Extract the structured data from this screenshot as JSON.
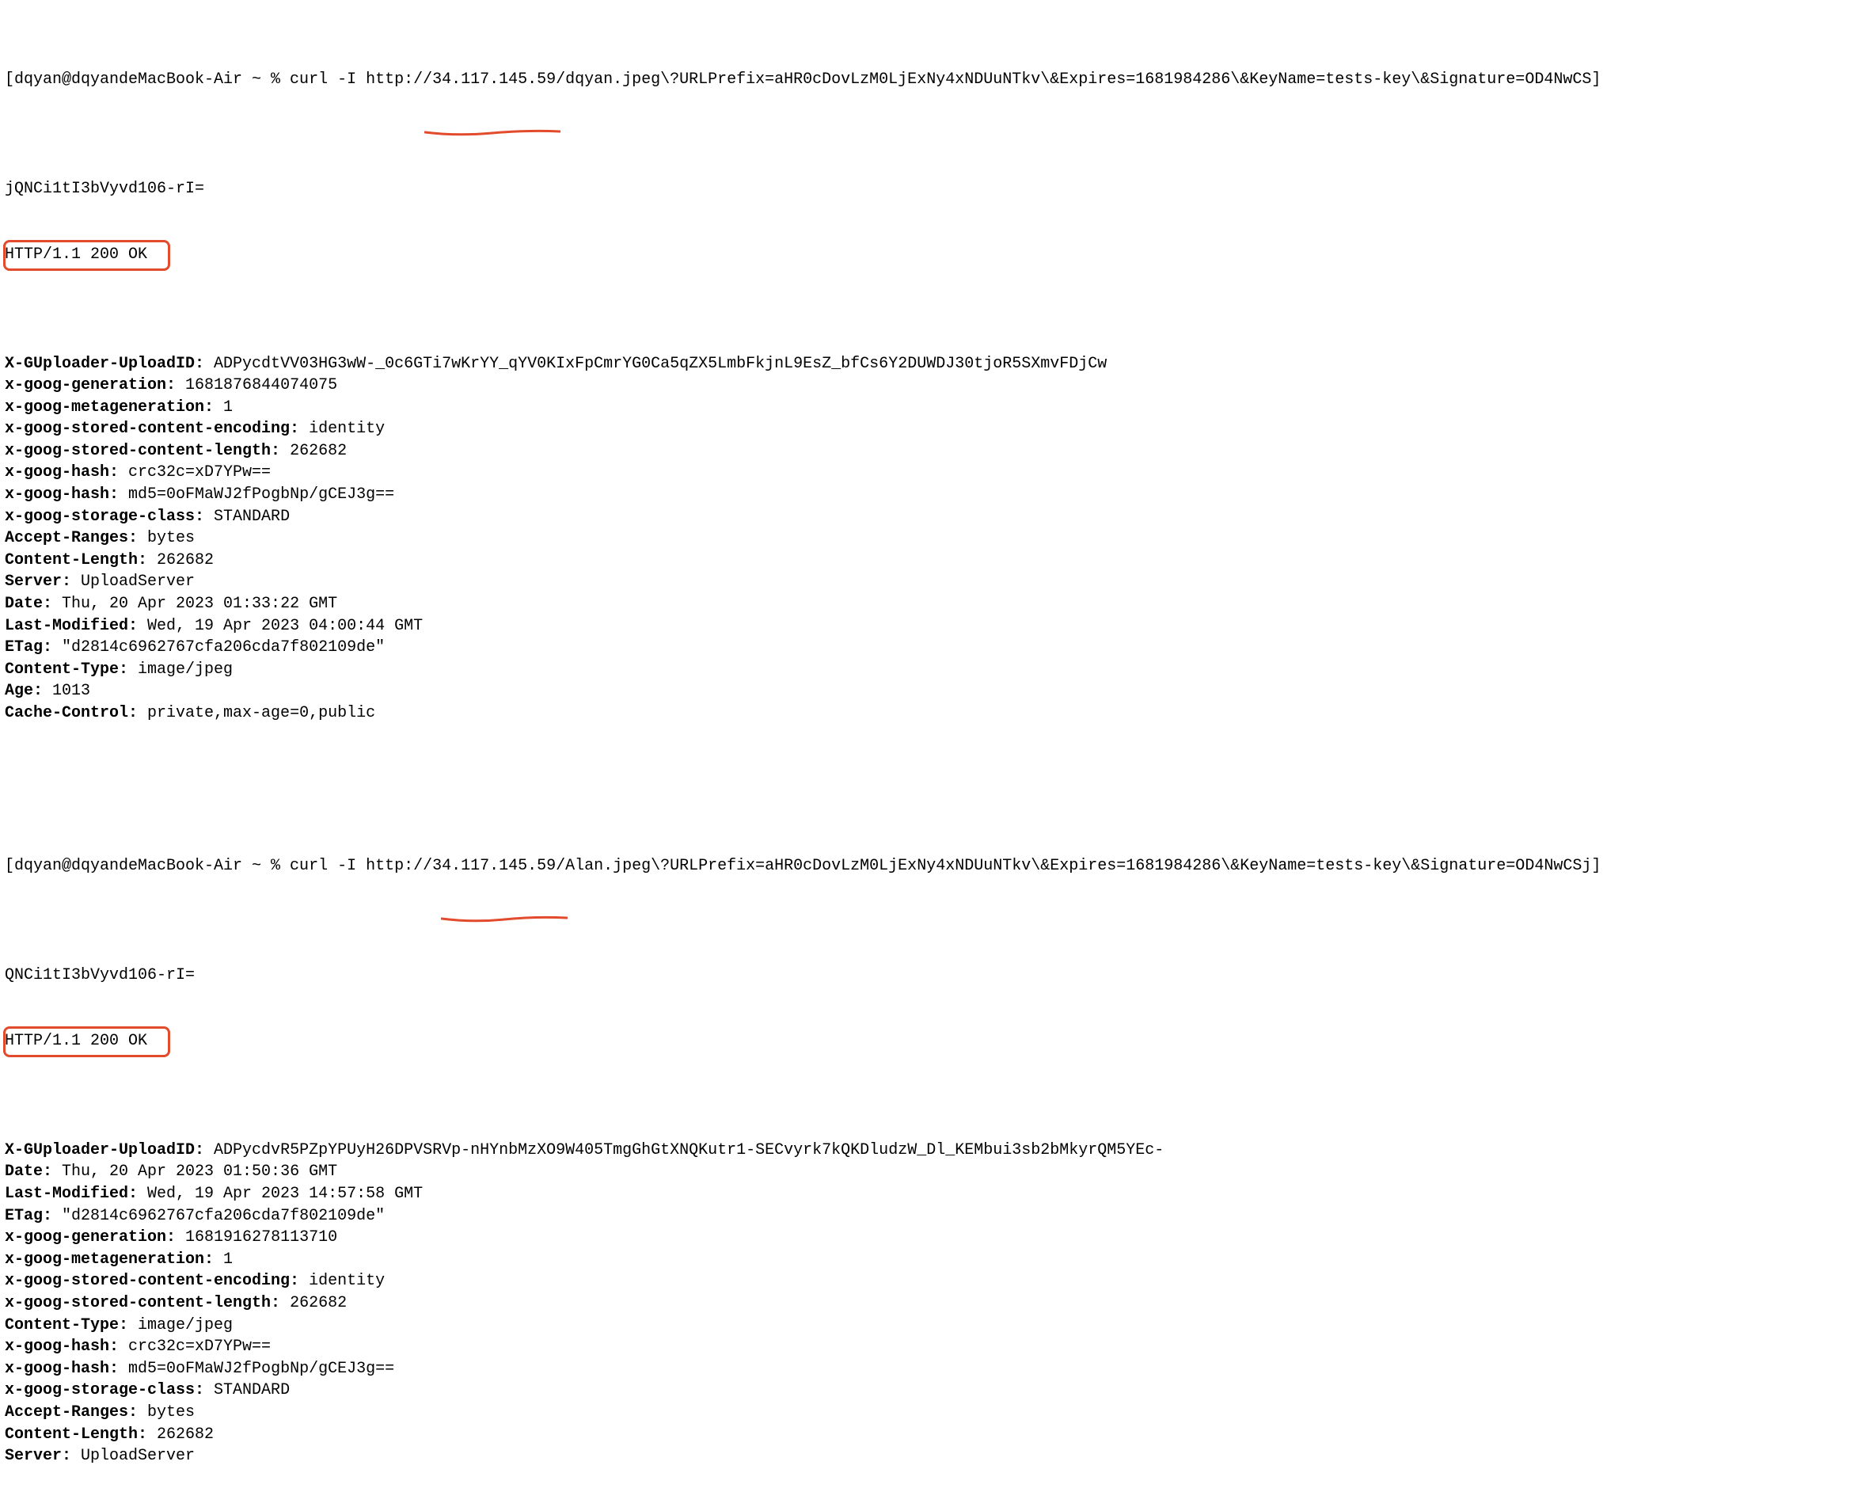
{
  "term": {
    "r1": {
      "prompt1": "[dqyan@dqyandeMacBook-Air ~ % curl -I http://34.117.145.59/dqyan.jpeg\\?URLPrefix=aHR0cDovLzM0LjExNy4xNDUuNTkv\\&Expires=1681984286\\&KeyName=tests-key\\&Signature=OD4NwCS]",
      "prompt_cont": "jQNCi1tI3bVyvd106-rI=",
      "status": "HTTP/1.1 200 OK",
      "headers": [
        {
          "k": "X-GUploader-UploadID:",
          "v": " ADPycdtVV03HG3wW-_0c6GTi7wKrYY_qYV0KIxFpCmrYG0Ca5qZX5LmbFkjnL9EsZ_bfCs6Y2DUWDJ30tjoR5SXmvFDjCw"
        },
        {
          "k": "x-goog-generation:",
          "v": " 1681876844074075"
        },
        {
          "k": "x-goog-metageneration:",
          "v": " 1"
        },
        {
          "k": "x-goog-stored-content-encoding:",
          "v": " identity"
        },
        {
          "k": "x-goog-stored-content-length:",
          "v": " 262682"
        },
        {
          "k": "x-goog-hash:",
          "v": " crc32c=xD7YPw=="
        },
        {
          "k": "x-goog-hash:",
          "v": " md5=0oFMaWJ2fPogbNp/gCEJ3g=="
        },
        {
          "k": "x-goog-storage-class:",
          "v": " STANDARD"
        },
        {
          "k": "Accept-Ranges:",
          "v": " bytes"
        },
        {
          "k": "Content-Length:",
          "v": " 262682"
        },
        {
          "k": "Server:",
          "v": " UploadServer"
        },
        {
          "k": "Date:",
          "v": " Thu, 20 Apr 2023 01:33:22 GMT"
        },
        {
          "k": "Last-Modified:",
          "v": " Wed, 19 Apr 2023 04:00:44 GMT"
        },
        {
          "k": "ETag:",
          "v": " \"d2814c6962767cfa206cda7f802109de\""
        },
        {
          "k": "Content-Type:",
          "v": " image/jpeg"
        },
        {
          "k": "Age:",
          "v": " 1013"
        },
        {
          "k": "Cache-Control:",
          "v": " private,max-age=0,public"
        }
      ]
    },
    "r2": {
      "prompt1": "[dqyan@dqyandeMacBook-Air ~ % curl -I http://34.117.145.59/Alan.jpeg\\?URLPrefix=aHR0cDovLzM0LjExNy4xNDUuNTkv\\&Expires=1681984286\\&KeyName=tests-key\\&Signature=OD4NwCSj]",
      "prompt_cont": "QNCi1tI3bVyvd106-rI=",
      "status": "HTTP/1.1 200 OK",
      "headers": [
        {
          "k": "X-GUploader-UploadID:",
          "v": " ADPycdvR5PZpYPUyH26DPVSRVp-nHYnbMzXO9W405TmgGhGtXNQKutr1-SECvyrk7kQKDludzW_Dl_KEMbui3sb2bMkyrQM5YEc-"
        },
        {
          "k": "Date:",
          "v": " Thu, 20 Apr 2023 01:50:36 GMT"
        },
        {
          "k": "Last-Modified:",
          "v": " Wed, 19 Apr 2023 14:57:58 GMT"
        },
        {
          "k": "ETag:",
          "v": " \"d2814c6962767cfa206cda7f802109de\""
        },
        {
          "k": "x-goog-generation:",
          "v": " 1681916278113710"
        },
        {
          "k": "x-goog-metageneration:",
          "v": " 1"
        },
        {
          "k": "x-goog-stored-content-encoding:",
          "v": " identity"
        },
        {
          "k": "x-goog-stored-content-length:",
          "v": " 262682"
        },
        {
          "k": "Content-Type:",
          "v": " image/jpeg"
        },
        {
          "k": "x-goog-hash:",
          "v": " crc32c=xD7YPw=="
        },
        {
          "k": "x-goog-hash:",
          "v": " md5=0oFMaWJ2fPogbNp/gCEJ3g=="
        },
        {
          "k": "x-goog-storage-class:",
          "v": " STANDARD"
        },
        {
          "k": "Accept-Ranges:",
          "v": " bytes"
        },
        {
          "k": "Content-Length:",
          "v": " 262682"
        },
        {
          "k": "Server:",
          "v": " UploadServer"
        }
      ]
    }
  }
}
